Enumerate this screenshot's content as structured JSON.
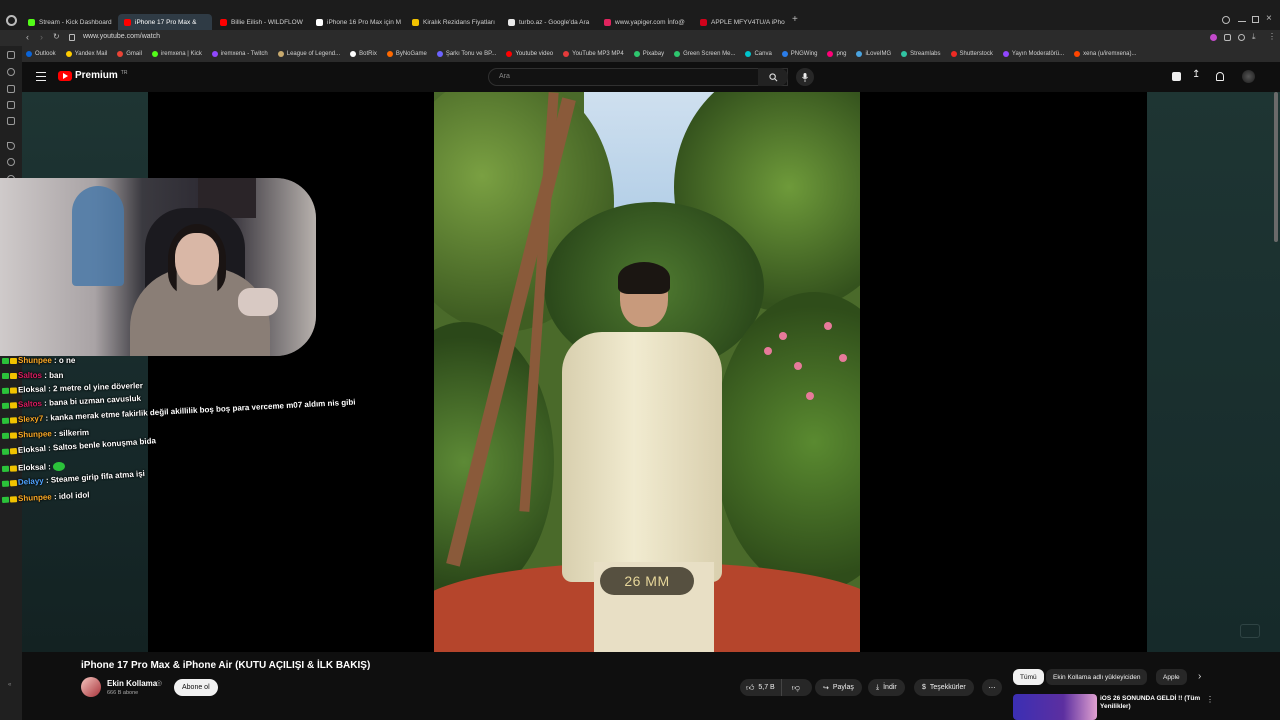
{
  "browser": {
    "tabs": [
      {
        "label": "Stream - Kick Dashboard",
        "color": "#53fc18"
      },
      {
        "label": "iPhone 17 Pro Max &",
        "color": "#ff0000"
      },
      {
        "label": "Billie Eilish - WILDFLOW",
        "color": "#ff0000"
      },
      {
        "label": "iPhone 16 Pro Max için M",
        "color": "#ffffff"
      },
      {
        "label": "Kiralık Rezidans Fiyatları",
        "color": "#f2c200"
      },
      {
        "label": "turbo.az - Google'da Ara",
        "color": "#e8e8e8"
      },
      {
        "label": "www.yapiger.com İnfo@",
        "color": "#e0245e"
      },
      {
        "label": "APPLE MFYV4TU/A iPho",
        "color": "#d0021b"
      }
    ],
    "url": "www.youtube.com/watch",
    "bookmarks": [
      {
        "label": "Outlook",
        "color": "#0a64d8"
      },
      {
        "label": "Yandex Mail",
        "color": "#ffcc00"
      },
      {
        "label": "Gmail",
        "color": "#ea4335"
      },
      {
        "label": "iremxena | Kick",
        "color": "#53fc18"
      },
      {
        "label": "iremxena - Twitch",
        "color": "#9146ff"
      },
      {
        "label": "League of Legend...",
        "color": "#c8aa6e"
      },
      {
        "label": "BotRix",
        "color": "#ffffff"
      },
      {
        "label": "ByNoGame",
        "color": "#ff6a00"
      },
      {
        "label": "Şarkı Tonu ve BP...",
        "color": "#6c63ff"
      },
      {
        "label": "Youtube video",
        "color": "#ff0000"
      },
      {
        "label": "YouTube MP3 MP4",
        "color": "#e43b3b"
      },
      {
        "label": "Pixabay",
        "color": "#2ec66e"
      },
      {
        "label": "Green Screen Me...",
        "color": "#2ec66e"
      },
      {
        "label": "Canva",
        "color": "#00c4cc"
      },
      {
        "label": "PNGWing",
        "color": "#2b7de9"
      },
      {
        "label": "png",
        "color": "#ff0077"
      },
      {
        "label": "iLoveIMG",
        "color": "#4aa3df"
      },
      {
        "label": "Streamlabs",
        "color": "#31c3a2"
      },
      {
        "label": "Shutterstock",
        "color": "#ee2b24"
      },
      {
        "label": "Yayın Moderatörü...",
        "color": "#9146ff"
      },
      {
        "label": "xena (u/iremxena)...",
        "color": "#ff4500"
      }
    ]
  },
  "youtube": {
    "logo_text": "Premium",
    "logo_region": "TR",
    "search_placeholder": "Ara"
  },
  "video": {
    "overlay_text": "26 MM",
    "title": "iPhone 17 Pro Max & iPhone Air (KUTU AÇILIŞI & İLK BAKIŞ)",
    "channel": "Ekin Kollama",
    "verified_mark": "◎",
    "subscribers": "666 B abone",
    "subscribe_label": "Abone ol",
    "like_count": "5,7 B",
    "share_label": "Paylaş",
    "download_label": "İndir",
    "thanks_label": "Teşekkürler"
  },
  "chips": [
    "Tümü",
    "Ekin Kollama adlı yükleyiciden",
    "Apple"
  ],
  "recommendation": {
    "title": "iOS 26 SONUNDA GELDİ !! (Tüm Yenilikler)"
  },
  "chat": [
    {
      "user": "Shunpee",
      "color": "#f9a825",
      "text": "o ne",
      "rot": 0
    },
    {
      "user": "Saltos",
      "color": "#d81b60",
      "text": "ban",
      "rot": 0
    },
    {
      "user": "Eloksal",
      "color": "#ffffff",
      "text": "2 metre ol yine döverler",
      "rot": -2
    },
    {
      "user": "Saltos",
      "color": "#d81b60",
      "text": "bana bi uzman cavusluk",
      "rot": -3
    },
    {
      "user": "Slexy7",
      "color": "#f9a825",
      "text": "kanka merak etme fakirlik değil akillilik boş boş para verceme m07 aldım nis gibi",
      "rot": -3
    },
    {
      "user": "Shunpee",
      "color": "#f9a825",
      "text": "silkerim",
      "rot": -2
    },
    {
      "user": "Eloksal",
      "color": "#ffffff",
      "text": "Saltos benle konuşma bida",
      "rot": -4
    },
    {
      "user": "Eloksal",
      "color": "#ffffff",
      "text": "",
      "rot": -2
    },
    {
      "user": "Delayy",
      "color": "#4fa3ff",
      "text": "Steame girip fifa atma işi",
      "rot": -4
    },
    {
      "user": "Shunpee",
      "color": "#f9a825",
      "text": "idol idol",
      "rot": -3
    }
  ]
}
